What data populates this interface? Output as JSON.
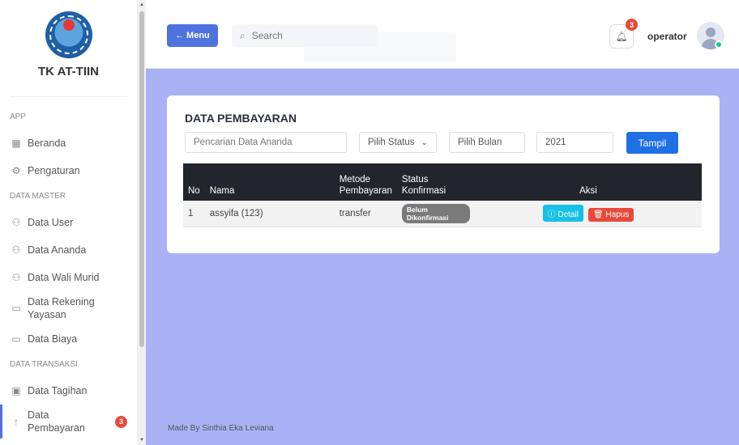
{
  "brand": {
    "name": "TK AT-TIIN"
  },
  "sidebar": {
    "sections": [
      "APP",
      "DATA MASTER",
      "DATA TRANSAKSI"
    ],
    "items": [
      {
        "label": "Beranda",
        "icon": "grid-icon"
      },
      {
        "label": "Pengaturan",
        "icon": "gear-icon"
      },
      {
        "label": "Data User",
        "icon": "users-icon"
      },
      {
        "label": "Data Ananda",
        "icon": "users-icon"
      },
      {
        "label": "Data Wali Murid",
        "icon": "users-icon"
      },
      {
        "label": "Data Rekening Yayasan",
        "icon": "card-icon"
      },
      {
        "label": "Data Biaya",
        "icon": "card-icon"
      },
      {
        "label": "Data Tagihan",
        "icon": "calendar-icon"
      },
      {
        "label": "Data Pembayaran",
        "icon": "arrow-icon",
        "badge": "3"
      }
    ]
  },
  "topbar": {
    "menu_label": "← Menu",
    "search_placeholder": "Search",
    "notification_count": "3",
    "user_name": "operator"
  },
  "card": {
    "title": "DATA PEMBAYARAN",
    "search_placeholder": "Pencarian Data Ananda",
    "status_select": "Pilih Status",
    "month_select": "Pilih Bulan",
    "year_value": "2021",
    "tampil_label": "Tampil"
  },
  "table": {
    "headers": [
      "No",
      "Nama",
      "Metode Pembayaran",
      "Status Konfirmasi",
      "Aksi"
    ],
    "rows": [
      {
        "no": "1",
        "nama": "assyifa (123)",
        "metode": "transfer",
        "status": "Belum Dikonfirmasi",
        "detail_label": "ⓘ Detail",
        "hapus_label": "🗑 Hapus"
      }
    ]
  },
  "footer": {
    "text": "Made By Sinthia Eka Leviana"
  },
  "colors": {
    "primary": "#4e73df",
    "danger": "#e74a3b",
    "info": "#17c0e6",
    "background": "#a8b2f5"
  }
}
